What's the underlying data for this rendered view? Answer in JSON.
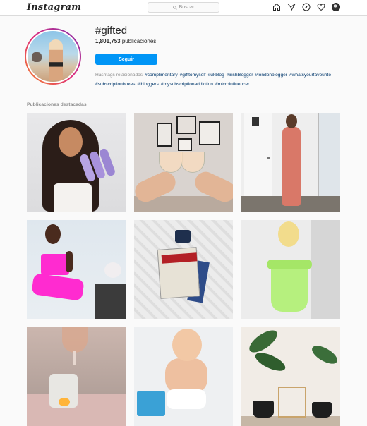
{
  "nav": {
    "logo": "Instagram",
    "search_placeholder": "Buscar",
    "icons": [
      "home-icon",
      "direct-icon",
      "explore-icon",
      "activity-icon",
      "profile-avatar"
    ]
  },
  "header": {
    "hashtag": "#gifted",
    "post_count": "1,801,753",
    "post_label": "publicaciones",
    "follow_label": "Seguir"
  },
  "related": {
    "label": "Hashtags relacionados",
    "tags": [
      "#complimentary",
      "#gifttomyself",
      "#ukblog",
      "#irishblogger",
      "#londonblogger",
      "#whatsyourfavourite",
      "#subscriptionboxes",
      "#lbloggers",
      "#mysubscriptionaddiction",
      "#microinfluencer"
    ]
  },
  "featured": {
    "title": "Publicaciones destacadas"
  },
  "colors": {
    "accent": "#0095f6",
    "link": "#00376b",
    "background": "#fafafa"
  }
}
